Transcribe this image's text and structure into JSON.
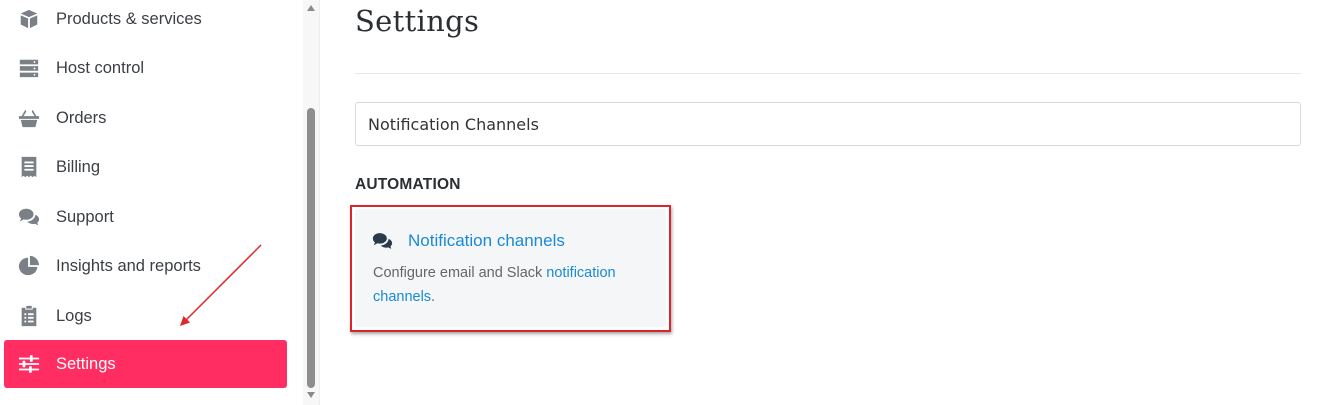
{
  "sidebar": {
    "items": [
      {
        "label": "Products & services",
        "icon": "box-icon",
        "active": false
      },
      {
        "label": "Host control",
        "icon": "server-icon",
        "active": false
      },
      {
        "label": "Orders",
        "icon": "basket-icon",
        "active": false
      },
      {
        "label": "Billing",
        "icon": "receipt-icon",
        "active": false
      },
      {
        "label": "Support",
        "icon": "comments-icon",
        "active": false
      },
      {
        "label": "Insights and reports",
        "icon": "pie-chart-icon",
        "active": false
      },
      {
        "label": "Logs",
        "icon": "clipboard-icon",
        "active": false
      },
      {
        "label": "Settings",
        "icon": "sliders-icon",
        "active": true
      }
    ]
  },
  "main": {
    "title": "Settings",
    "search_value": "Notification Channels",
    "section_heading": "AUTOMATION",
    "card": {
      "icon": "comments-icon",
      "title": "Notification channels",
      "desc_prefix": "Configure email and Slack ",
      "desc_link": "notification channels",
      "desc_suffix": "."
    }
  },
  "colors": {
    "accent": "#ff2d62",
    "link": "#1a8ad4",
    "highlight": "#d9262c"
  }
}
